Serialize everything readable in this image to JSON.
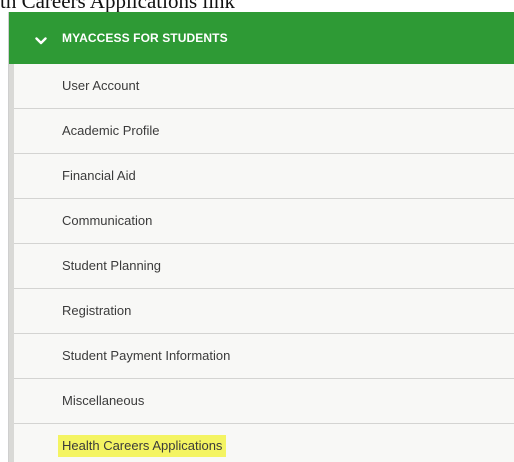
{
  "caption": "th Careers Applications link",
  "menu": {
    "header_label": "MYACCESS FOR STUDENTS",
    "header_icon": "chevron-down-icon",
    "colors": {
      "header_bg": "#2e9a35",
      "highlight": "#f4f462"
    },
    "items": [
      {
        "label": "User Account"
      },
      {
        "label": "Academic Profile"
      },
      {
        "label": "Financial Aid"
      },
      {
        "label": "Communication"
      },
      {
        "label": "Student Planning"
      },
      {
        "label": "Registration"
      },
      {
        "label": "Student Payment Information"
      },
      {
        "label": "Miscellaneous"
      },
      {
        "label": "Health Careers Applications"
      }
    ]
  }
}
